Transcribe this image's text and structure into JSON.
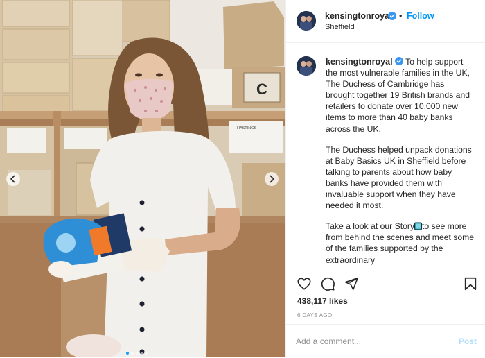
{
  "post": {
    "username": "kensingtonroyal",
    "location": "Sheffield",
    "follow_label": "Follow",
    "separator": "•",
    "accent_color": "#0095f6"
  },
  "caption": {
    "username": "kensingtonroyal",
    "paragraphs": [
      "To help support the most vulnerable families in the UK, The Duchess of Cambridge has brought together 19 British brands and retailers to donate over 10,000 new items to more than 40 baby banks across the UK.",
      "The Duchess helped unpack donations at Baby Basics UK in Sheffield before talking to parents about how baby banks have provided them with invaluable support when they have needed it most.",
      "Take a look at our Story",
      "to see more from behind the scenes and meet some of the families supported by the extraordinary"
    ]
  },
  "engagement": {
    "likes": "438,117 likes",
    "time_ago": "6 DAYS AGO"
  },
  "comment": {
    "placeholder": "Add a comment...",
    "post_label": "Post"
  },
  "carousel": {
    "slide_count": 5,
    "active_index": 0
  },
  "icons": [
    "verified-icon",
    "heart-icon",
    "comment-icon",
    "share-icon",
    "bookmark-icon",
    "chevron-left-icon",
    "chevron-right-icon",
    "tv-emoji-icon"
  ],
  "photo": {
    "box_label_c": "C",
    "box_label_hastings": "HASTINGS"
  }
}
